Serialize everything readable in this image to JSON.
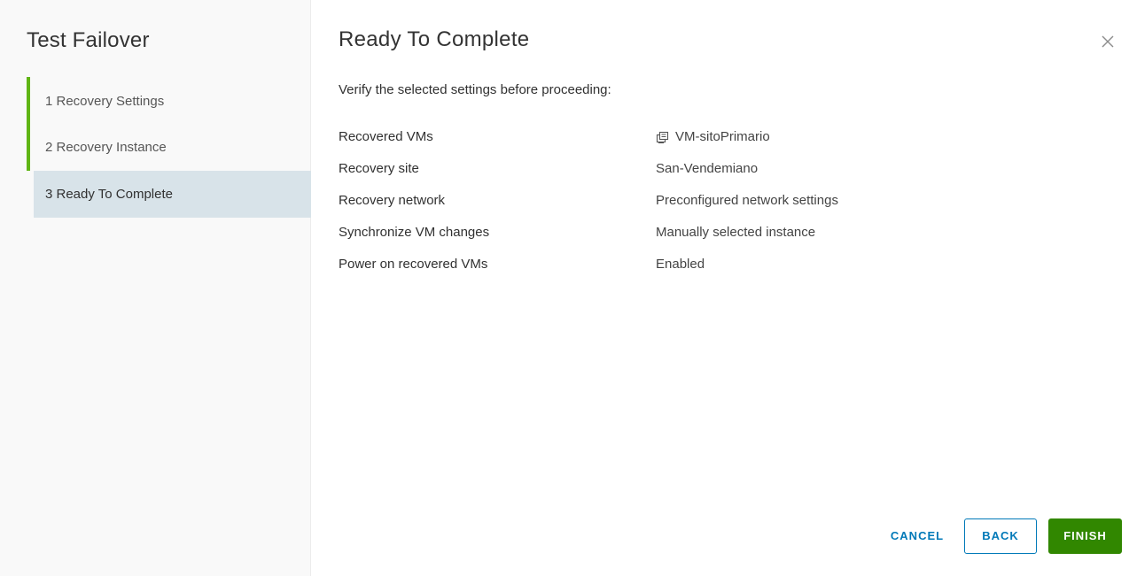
{
  "wizard": {
    "title": "Test Failover",
    "steps": [
      {
        "label": "1 Recovery Settings",
        "state": "completed"
      },
      {
        "label": "2 Recovery Instance",
        "state": "completed"
      },
      {
        "label": "3 Ready To Complete",
        "state": "active"
      }
    ]
  },
  "page": {
    "title": "Ready To Complete",
    "close_icon": "close-icon",
    "intro": "Verify the selected settings before proceeding:",
    "summary": [
      {
        "label": "Recovered VMs",
        "value": "VM-sitoPrimario",
        "icon": "vm-icon"
      },
      {
        "label": "Recovery site",
        "value": "San-Vendemiano"
      },
      {
        "label": "Recovery network",
        "value": "Preconfigured network settings"
      },
      {
        "label": "Synchronize VM changes",
        "value": "Manually selected instance"
      },
      {
        "label": "Power on recovered VMs",
        "value": "Enabled"
      }
    ]
  },
  "footer": {
    "cancel_label": "CANCEL",
    "back_label": "BACK",
    "finish_label": "FINISH"
  },
  "colors": {
    "step_complete_bar": "#60b515",
    "active_step_bg": "#d8e3e9",
    "link_blue": "#0079b8",
    "finish_green": "#318700"
  }
}
